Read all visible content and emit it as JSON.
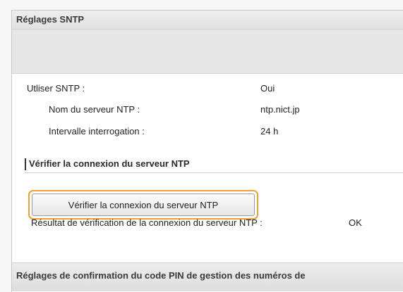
{
  "header": {
    "title": "Réglages SNTP"
  },
  "settings": {
    "use_sntp_label": "Utliser SNTP :",
    "use_sntp_value": "Oui",
    "ntp_server_label": "Nom du serveur NTP :",
    "ntp_server_value": "ntp.nict.jp",
    "interval_label": "Intervalle interrogation :",
    "interval_value": "24 h"
  },
  "verify_section": {
    "title": "Vérifier la connexion du serveur NTP",
    "button_label": "Vérifier la connexion du serveur NTP",
    "result_label": "Résultat de vérification de la connexion du serveur NTP :",
    "result_value": "OK"
  },
  "footer": {
    "title": "Réglages de confirmation du code PIN de gestion des numéros de"
  },
  "colors": {
    "highlight": "#f0a030",
    "header_bg": "#e6e6e6"
  }
}
